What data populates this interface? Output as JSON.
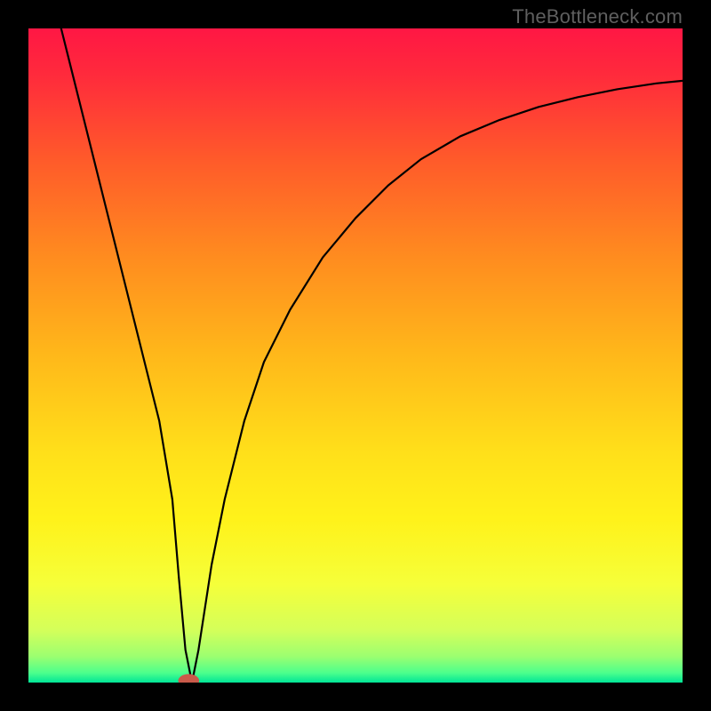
{
  "watermark": "TheBottleneck.com",
  "chart_data": {
    "type": "line",
    "title": "",
    "xlabel": "",
    "ylabel": "",
    "xlim": [
      0,
      100
    ],
    "ylim": [
      0,
      100
    ],
    "grid": false,
    "legend": false,
    "gradient_stops": [
      {
        "offset": 0.0,
        "color": "#ff1744"
      },
      {
        "offset": 0.07,
        "color": "#ff2a3c"
      },
      {
        "offset": 0.2,
        "color": "#ff5a2a"
      },
      {
        "offset": 0.35,
        "color": "#ff8c1f"
      },
      {
        "offset": 0.5,
        "color": "#ffb81a"
      },
      {
        "offset": 0.65,
        "color": "#ffe01a"
      },
      {
        "offset": 0.75,
        "color": "#fff21a"
      },
      {
        "offset": 0.85,
        "color": "#f5ff3a"
      },
      {
        "offset": 0.92,
        "color": "#d4ff5a"
      },
      {
        "offset": 0.96,
        "color": "#9cff70"
      },
      {
        "offset": 0.985,
        "color": "#4dff8c"
      },
      {
        "offset": 1.0,
        "color": "#00e596"
      }
    ],
    "series": [
      {
        "name": "bottleneck-curve",
        "stroke": "#000000",
        "stroke_width": 2.2,
        "x": [
          0,
          2,
          4,
          6,
          8,
          10,
          12,
          14,
          16,
          18,
          20,
          22,
          23,
          24,
          25,
          26,
          28,
          30,
          33,
          36,
          40,
          45,
          50,
          55,
          60,
          66,
          72,
          78,
          84,
          90,
          96,
          100
        ],
        "values": [
          120,
          112,
          104,
          96,
          88,
          80,
          72,
          64,
          56,
          48,
          40,
          28,
          16,
          5,
          0,
          5,
          18,
          28,
          40,
          49,
          57,
          65,
          71,
          76,
          80,
          83.5,
          86,
          88,
          89.5,
          90.7,
          91.6,
          92
        ]
      }
    ],
    "markers": [
      {
        "name": "min-point",
        "x": 24.5,
        "y": 0.3,
        "rx": 1.6,
        "ry": 1.0,
        "fill": "#c95a4a"
      }
    ]
  }
}
